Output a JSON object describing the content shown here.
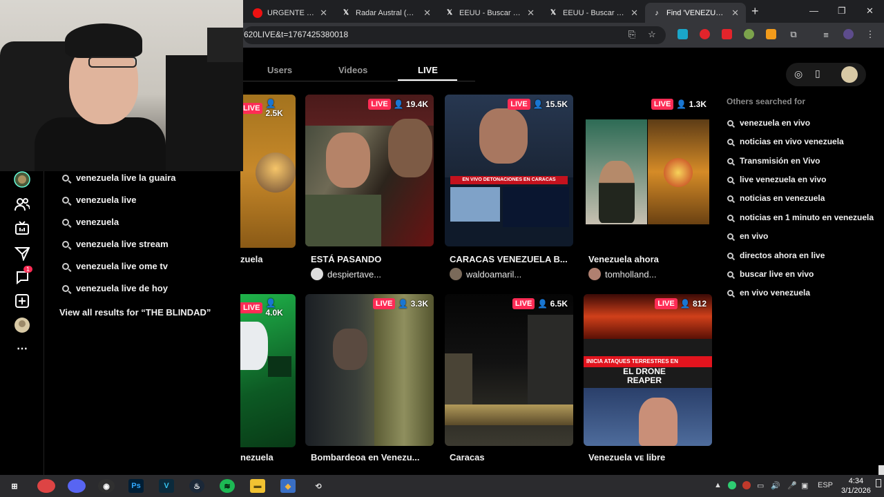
{
  "browser": {
    "tabs": [
      {
        "title": "URGENTE - EX",
        "icon": "red-dot-icon",
        "active": false
      },
      {
        "title": "Radar Austral (@R",
        "icon": "x-logo-icon",
        "active": false
      },
      {
        "title": "EEUU - Buscar / X",
        "icon": "x-logo-icon",
        "active": false
      },
      {
        "title": "EEUU - Buscar / X",
        "icon": "x-logo-icon",
        "active": false
      },
      {
        "title": "Find 'VENEZUELA",
        "icon": "tiktok-icon",
        "active": true
      }
    ],
    "url": "620LIVE&t=1767425380018"
  },
  "suggestions": {
    "items": [
      "venezuela live la guaira",
      "venezuela live",
      "venezuela",
      "venezuela live stream",
      "venezuela live ome tv",
      "venezuela live de hoy"
    ],
    "view_all": "View all results for “THE BLINDAD”"
  },
  "rail": {
    "notification_count": "1"
  },
  "tabs": {
    "users": "Users",
    "videos": "Videos",
    "live": "LIVE"
  },
  "live_label": "LIVE",
  "cards": [
    {
      "views": "2.5K",
      "title": "zuela",
      "user": ""
    },
    {
      "views": "19.4K",
      "title": "ESTÁ PASANDO",
      "user": "despiertave..."
    },
    {
      "views": "15.5K",
      "title": "CARACAS VENEZUELA B...",
      "user": "waldoamaril..."
    },
    {
      "views": "1.3K",
      "title": "Venezuela ahora",
      "user": "tomholland..."
    },
    {
      "views": "4.0K",
      "title": "nezuela",
      "user": ""
    },
    {
      "views": "3.3K",
      "title": "Bombardeoa en Venezu...",
      "user": ""
    },
    {
      "views": "6.5K",
      "title": "Caracas",
      "user": ""
    },
    {
      "views": "812",
      "title": "Venezuela ᴠᴇ libre",
      "user": ""
    }
  ],
  "overlays": {
    "card3_banner": "EN VIVO DETONACIONES EN CARACAS",
    "card8_banner": "INICIA ATAQUES TERRESTRES EN",
    "card8_title1": "EL DRONE",
    "card8_title2": "REAPER"
  },
  "others": {
    "heading": "Others searched for",
    "items": [
      "venezuela en vivo",
      "noticias en vivo venezuela",
      "Transmisión en Vivo",
      "live venezuela en vivo",
      "noticias en venezuela",
      "noticias en 1 minuto en venezuela",
      "en vivo",
      "directos ahora en live",
      "buscar live en vivo",
      "en vivo venezuela"
    ]
  },
  "taskbar": {
    "time": "4:34",
    "date": "3/1/2026",
    "lang": "ESP"
  },
  "colors": {
    "accent": "#fe2c55",
    "chrome_bg": "#35363a"
  }
}
